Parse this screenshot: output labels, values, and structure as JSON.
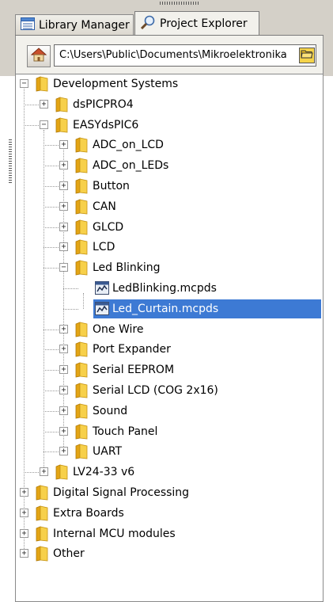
{
  "tabs": [
    {
      "label": "Library Manager",
      "active": false
    },
    {
      "label": "Project Explorer",
      "active": true
    }
  ],
  "path": {
    "value": "C:\\Users\\Public\\Documents\\Mikroelektronika"
  },
  "tree": [
    {
      "label": "Development Systems",
      "level": 0,
      "expanded": true,
      "type": "folder"
    },
    {
      "label": "dsPICPRO4",
      "level": 1,
      "expanded": false,
      "type": "folder"
    },
    {
      "label": "EASYdsPIC6",
      "level": 1,
      "expanded": true,
      "type": "folder"
    },
    {
      "label": "ADC_on_LCD",
      "level": 2,
      "expanded": false,
      "type": "folder"
    },
    {
      "label": "ADC_on_LEDs",
      "level": 2,
      "expanded": false,
      "type": "folder"
    },
    {
      "label": "Button",
      "level": 2,
      "expanded": false,
      "type": "folder"
    },
    {
      "label": "CAN",
      "level": 2,
      "expanded": false,
      "type": "folder"
    },
    {
      "label": "GLCD",
      "level": 2,
      "expanded": false,
      "type": "folder"
    },
    {
      "label": "LCD",
      "level": 2,
      "expanded": false,
      "type": "folder"
    },
    {
      "label": "Led Blinking",
      "level": 2,
      "expanded": true,
      "type": "folder"
    },
    {
      "label": "LedBlinking.mcpds",
      "level": 3,
      "type": "file"
    },
    {
      "label": "Led_Curtain.mcpds",
      "level": 3,
      "type": "file",
      "selected": true
    },
    {
      "label": "One Wire",
      "level": 2,
      "expanded": false,
      "type": "folder"
    },
    {
      "label": "Port Expander",
      "level": 2,
      "expanded": false,
      "type": "folder"
    },
    {
      "label": "Serial EEPROM",
      "level": 2,
      "expanded": false,
      "type": "folder"
    },
    {
      "label": "Serial LCD (COG 2x16)",
      "level": 2,
      "expanded": false,
      "type": "folder"
    },
    {
      "label": "Sound",
      "level": 2,
      "expanded": false,
      "type": "folder"
    },
    {
      "label": "Touch Panel",
      "level": 2,
      "expanded": false,
      "type": "folder"
    },
    {
      "label": "UART",
      "level": 2,
      "expanded": false,
      "type": "folder"
    },
    {
      "label": "LV24-33 v6",
      "level": 1,
      "expanded": false,
      "type": "folder"
    },
    {
      "label": "Digital Signal Processing",
      "level": 0,
      "expanded": false,
      "type": "folder"
    },
    {
      "label": "Extra Boards",
      "level": 0,
      "expanded": false,
      "type": "folder"
    },
    {
      "label": "Internal MCU modules",
      "level": 0,
      "expanded": false,
      "type": "folder"
    },
    {
      "label": "Other",
      "level": 0,
      "expanded": false,
      "type": "folder"
    }
  ],
  "colors": {
    "selection": "#3d7ad4",
    "folder": "#f2c230",
    "chrome": "#d4d0c8"
  }
}
